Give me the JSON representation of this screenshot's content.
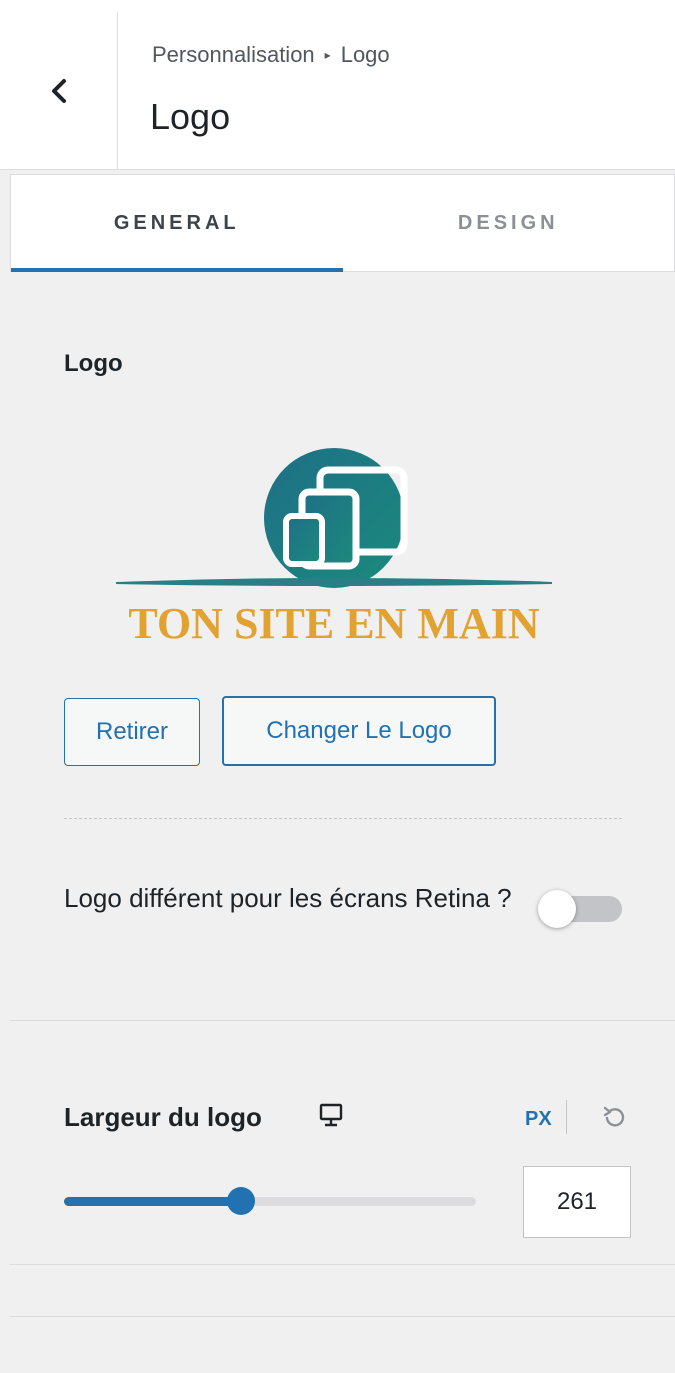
{
  "header": {
    "breadcrumb_parent": "Personnalisation",
    "breadcrumb_current": "Logo",
    "title": "Logo"
  },
  "tabs": [
    {
      "label": "GENERAL",
      "active": true
    },
    {
      "label": "DESIGN",
      "active": false
    }
  ],
  "logo_section": {
    "label": "Logo",
    "logo_text": "TON SITE EN MAIN",
    "remove_label": "Retirer",
    "change_label": "Changer Le Logo"
  },
  "retina": {
    "label": "Logo différent pour les écrans Retina ?",
    "enabled": false
  },
  "logo_width": {
    "label": "Largeur du logo",
    "unit": "PX",
    "value": "261",
    "slider_fraction": 0.43
  },
  "colors": {
    "accent": "#2271b1",
    "logo_teal": "#1f7a82",
    "logo_gold": "#e2a232"
  },
  "icons": {
    "back": "chevron-left-icon",
    "device": "monitor-icon",
    "reset": "reset-icon"
  }
}
